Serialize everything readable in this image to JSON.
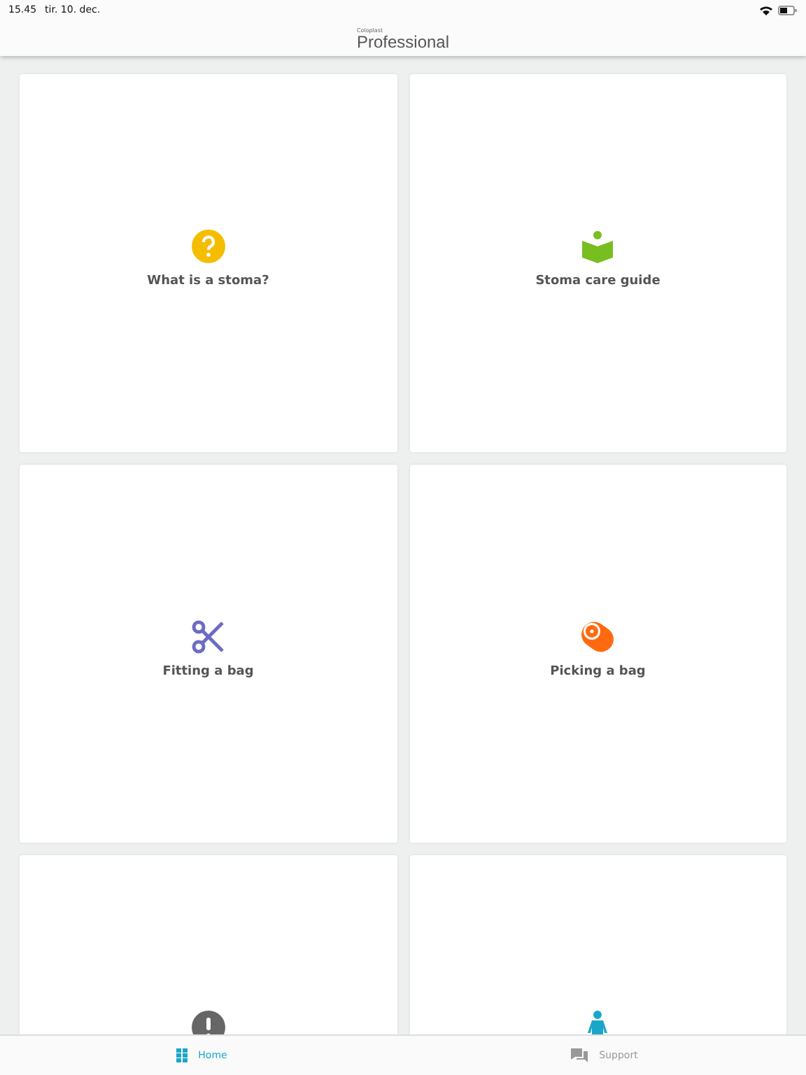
{
  "status_bar": {
    "time": "15.45",
    "date": "tir. 10. dec."
  },
  "header": {
    "brand": "Coloplast",
    "title": "Professional"
  },
  "tiles": [
    {
      "kind": "question",
      "label": "What is a stoma?"
    },
    {
      "kind": "book",
      "label": "Stoma care guide"
    },
    {
      "kind": "scissors",
      "label": "Fitting a bag"
    },
    {
      "kind": "tag",
      "label": "Picking a bag"
    },
    {
      "kind": "alert"
    },
    {
      "kind": "person"
    }
  ],
  "tab_bar": [
    {
      "kind": "grid",
      "label": "Home",
      "selected": true
    },
    {
      "kind": "chat",
      "label": "Support",
      "selected": false
    }
  ]
}
